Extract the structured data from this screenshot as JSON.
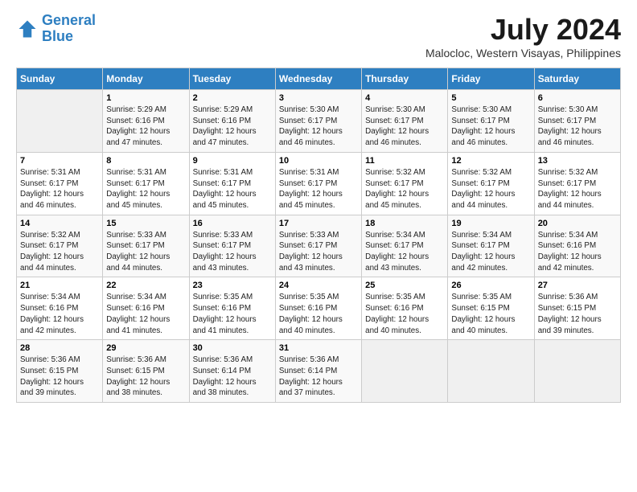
{
  "logo": {
    "line1": "General",
    "line2": "Blue"
  },
  "title": "July 2024",
  "subtitle": "Malocloc, Western Visayas, Philippines",
  "header_days": [
    "Sunday",
    "Monday",
    "Tuesday",
    "Wednesday",
    "Thursday",
    "Friday",
    "Saturday"
  ],
  "weeks": [
    [
      {
        "num": "",
        "info": ""
      },
      {
        "num": "1",
        "info": "Sunrise: 5:29 AM\nSunset: 6:16 PM\nDaylight: 12 hours\nand 47 minutes."
      },
      {
        "num": "2",
        "info": "Sunrise: 5:29 AM\nSunset: 6:16 PM\nDaylight: 12 hours\nand 47 minutes."
      },
      {
        "num": "3",
        "info": "Sunrise: 5:30 AM\nSunset: 6:17 PM\nDaylight: 12 hours\nand 46 minutes."
      },
      {
        "num": "4",
        "info": "Sunrise: 5:30 AM\nSunset: 6:17 PM\nDaylight: 12 hours\nand 46 minutes."
      },
      {
        "num": "5",
        "info": "Sunrise: 5:30 AM\nSunset: 6:17 PM\nDaylight: 12 hours\nand 46 minutes."
      },
      {
        "num": "6",
        "info": "Sunrise: 5:30 AM\nSunset: 6:17 PM\nDaylight: 12 hours\nand 46 minutes."
      }
    ],
    [
      {
        "num": "7",
        "info": "Sunrise: 5:31 AM\nSunset: 6:17 PM\nDaylight: 12 hours\nand 46 minutes."
      },
      {
        "num": "8",
        "info": "Sunrise: 5:31 AM\nSunset: 6:17 PM\nDaylight: 12 hours\nand 45 minutes."
      },
      {
        "num": "9",
        "info": "Sunrise: 5:31 AM\nSunset: 6:17 PM\nDaylight: 12 hours\nand 45 minutes."
      },
      {
        "num": "10",
        "info": "Sunrise: 5:31 AM\nSunset: 6:17 PM\nDaylight: 12 hours\nand 45 minutes."
      },
      {
        "num": "11",
        "info": "Sunrise: 5:32 AM\nSunset: 6:17 PM\nDaylight: 12 hours\nand 45 minutes."
      },
      {
        "num": "12",
        "info": "Sunrise: 5:32 AM\nSunset: 6:17 PM\nDaylight: 12 hours\nand 44 minutes."
      },
      {
        "num": "13",
        "info": "Sunrise: 5:32 AM\nSunset: 6:17 PM\nDaylight: 12 hours\nand 44 minutes."
      }
    ],
    [
      {
        "num": "14",
        "info": "Sunrise: 5:32 AM\nSunset: 6:17 PM\nDaylight: 12 hours\nand 44 minutes."
      },
      {
        "num": "15",
        "info": "Sunrise: 5:33 AM\nSunset: 6:17 PM\nDaylight: 12 hours\nand 44 minutes."
      },
      {
        "num": "16",
        "info": "Sunrise: 5:33 AM\nSunset: 6:17 PM\nDaylight: 12 hours\nand 43 minutes."
      },
      {
        "num": "17",
        "info": "Sunrise: 5:33 AM\nSunset: 6:17 PM\nDaylight: 12 hours\nand 43 minutes."
      },
      {
        "num": "18",
        "info": "Sunrise: 5:34 AM\nSunset: 6:17 PM\nDaylight: 12 hours\nand 43 minutes."
      },
      {
        "num": "19",
        "info": "Sunrise: 5:34 AM\nSunset: 6:17 PM\nDaylight: 12 hours\nand 42 minutes."
      },
      {
        "num": "20",
        "info": "Sunrise: 5:34 AM\nSunset: 6:16 PM\nDaylight: 12 hours\nand 42 minutes."
      }
    ],
    [
      {
        "num": "21",
        "info": "Sunrise: 5:34 AM\nSunset: 6:16 PM\nDaylight: 12 hours\nand 42 minutes."
      },
      {
        "num": "22",
        "info": "Sunrise: 5:34 AM\nSunset: 6:16 PM\nDaylight: 12 hours\nand 41 minutes."
      },
      {
        "num": "23",
        "info": "Sunrise: 5:35 AM\nSunset: 6:16 PM\nDaylight: 12 hours\nand 41 minutes."
      },
      {
        "num": "24",
        "info": "Sunrise: 5:35 AM\nSunset: 6:16 PM\nDaylight: 12 hours\nand 40 minutes."
      },
      {
        "num": "25",
        "info": "Sunrise: 5:35 AM\nSunset: 6:16 PM\nDaylight: 12 hours\nand 40 minutes."
      },
      {
        "num": "26",
        "info": "Sunrise: 5:35 AM\nSunset: 6:15 PM\nDaylight: 12 hours\nand 40 minutes."
      },
      {
        "num": "27",
        "info": "Sunrise: 5:36 AM\nSunset: 6:15 PM\nDaylight: 12 hours\nand 39 minutes."
      }
    ],
    [
      {
        "num": "28",
        "info": "Sunrise: 5:36 AM\nSunset: 6:15 PM\nDaylight: 12 hours\nand 39 minutes."
      },
      {
        "num": "29",
        "info": "Sunrise: 5:36 AM\nSunset: 6:15 PM\nDaylight: 12 hours\nand 38 minutes."
      },
      {
        "num": "30",
        "info": "Sunrise: 5:36 AM\nSunset: 6:14 PM\nDaylight: 12 hours\nand 38 minutes."
      },
      {
        "num": "31",
        "info": "Sunrise: 5:36 AM\nSunset: 6:14 PM\nDaylight: 12 hours\nand 37 minutes."
      },
      {
        "num": "",
        "info": ""
      },
      {
        "num": "",
        "info": ""
      },
      {
        "num": "",
        "info": ""
      }
    ]
  ]
}
